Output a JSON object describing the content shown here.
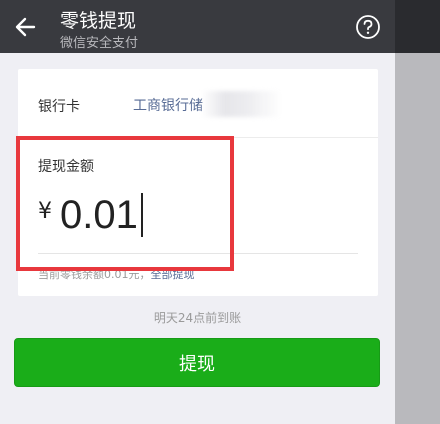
{
  "header": {
    "title": "零钱提现",
    "subtitle": "微信安全支付",
    "back_icon": "arrow-left-icon",
    "help_icon": "question-circle-icon"
  },
  "bank": {
    "label": "银行卡",
    "name": "工商银行储"
  },
  "amount": {
    "label": "提现金额",
    "currency": "¥",
    "value": "0.01"
  },
  "balance": {
    "text": "当前零钱余额0.01元，",
    "withdraw_all": "全部提现"
  },
  "arrive_time": "明天24点前到账",
  "submit_label": "提现",
  "colors": {
    "header_bg": "#393a3f",
    "primary_green": "#1aad19",
    "link_blue": "#576b95",
    "highlight_red": "#e8383d"
  }
}
